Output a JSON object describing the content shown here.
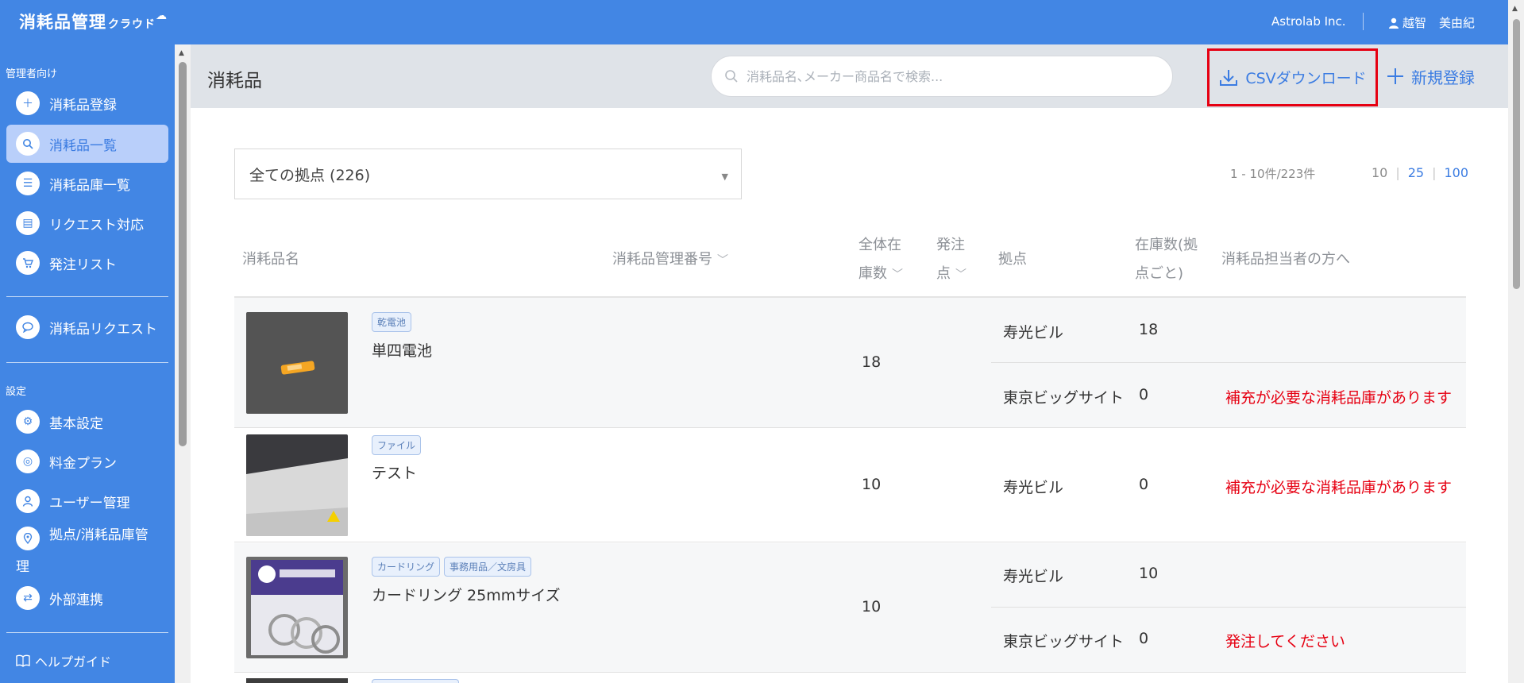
{
  "header": {
    "logo_main": "消耗品管理",
    "logo_sub": "クラウド",
    "org": "Astrolab Inc.",
    "user_last": "越智",
    "user_first": "美由紀",
    "brand_color": "#4286e4"
  },
  "sidebar": {
    "section_admin": "管理者向け",
    "section_settings": "設定",
    "items": [
      {
        "label": "消耗品登録",
        "icon": "plus-circle-icon",
        "glyph": "+"
      },
      {
        "label": "消耗品一覧",
        "icon": "search-icon",
        "glyph": "⌕",
        "active": true
      },
      {
        "label": "消耗品庫一覧",
        "icon": "list-icon",
        "glyph": "☰"
      },
      {
        "label": "リクエスト対応",
        "icon": "clipboard-icon",
        "glyph": "▤"
      },
      {
        "label": "発注リスト",
        "icon": "cart-icon",
        "glyph": "🛒"
      },
      {
        "label": "消耗品リクエスト",
        "icon": "chat-bubble-icon",
        "glyph": "💬"
      },
      {
        "label": "基本設定",
        "icon": "gear-icon",
        "glyph": "⚙"
      },
      {
        "label": "料金プラン",
        "icon": "coins-icon",
        "glyph": "◎"
      },
      {
        "label": "ユーザー管理",
        "icon": "user-icon",
        "glyph": "👤"
      },
      {
        "label": "拠点/消耗品庫管",
        "label2": "理",
        "icon": "location-pin-icon",
        "glyph": "⌖"
      },
      {
        "label": "外部連携",
        "icon": "swap-icon",
        "glyph": "⇄"
      }
    ],
    "help": "ヘルプガイド"
  },
  "main": {
    "title": "消耗品",
    "search_placeholder": "消耗品名､メーカー商品名で検索...",
    "csv_button": "CSVダウンロード",
    "new_button": "新規登録",
    "filter_value": "全ての拠点 (226)",
    "count_text": "1 - 10件/223件",
    "per_page": [
      "10",
      "25",
      "100"
    ],
    "alert_color": "#e60012"
  },
  "table": {
    "headers": {
      "name": "消耗品名",
      "mgmt_no": "消耗品管理番号",
      "total_stock_1": "全体在",
      "total_stock_2": "庫数",
      "order_point_1": "発注",
      "order_point_2": "点",
      "location": "拠点",
      "stock_per_loc_1": "在庫数(拠",
      "stock_per_loc_2": "点ごと)",
      "to_manager": "消耗品担当者の方へ"
    },
    "rows": [
      {
        "tags": [
          "乾電池"
        ],
        "name": "単四電池",
        "total": "18",
        "locations": [
          {
            "name": "寿光ビル",
            "stock": "18",
            "note": ""
          },
          {
            "name": "東京ビッグサイト",
            "stock": "0",
            "note": "補充が必要な消耗品庫があります"
          }
        ]
      },
      {
        "tags": [
          "ファイル"
        ],
        "name": "テスト",
        "total": "10",
        "locations": [
          {
            "name": "寿光ビル",
            "stock": "0",
            "note": "補充が必要な消耗品庫があります"
          }
        ]
      },
      {
        "tags": [
          "カードリング",
          "事務用品／文房具"
        ],
        "name": "カードリング 25mmサイズ",
        "total": "10",
        "locations": [
          {
            "name": "寿光ビル",
            "stock": "10",
            "note": ""
          },
          {
            "name": "東京ビッグサイト",
            "stock": "0",
            "note": "発注してください"
          }
        ]
      }
    ]
  }
}
